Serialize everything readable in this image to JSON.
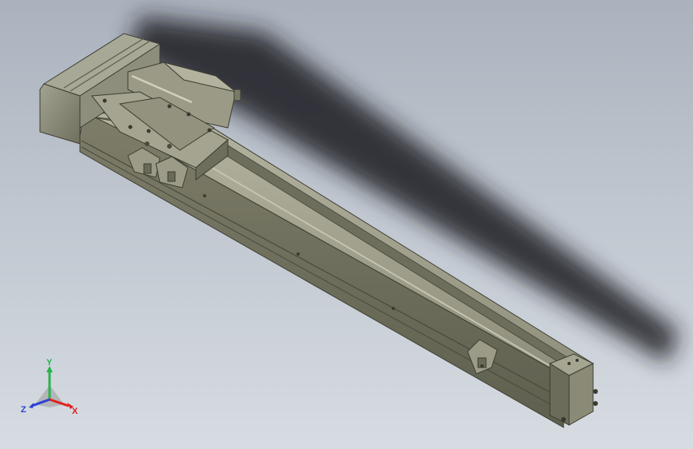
{
  "app": {
    "title": "",
    "view": "isometric"
  },
  "model": {
    "name": "",
    "components": [
      {
        "name": "servo-motor",
        "description_color": "#8c8c7c"
      },
      {
        "name": "actuator-rail",
        "description_color": "#8a8a74"
      },
      {
        "name": "carriage",
        "description_color": "#8f8f7d"
      },
      {
        "name": "sensor-brackets",
        "description_color": "#9b9b87"
      },
      {
        "name": "end-block",
        "description_color": "#8c8c78"
      }
    ]
  },
  "triad": {
    "axes": [
      {
        "label": "Y",
        "color": "#27b34b"
      },
      {
        "label": "X",
        "color": "#e02020"
      },
      {
        "label": "Z",
        "color": "#2b3fd6"
      }
    ]
  },
  "colors": {
    "background_top": "#aab2bd",
    "background_bottom": "#d7dce2",
    "metal_light": "#a6a692",
    "metal_mid": "#8a8a76",
    "metal_dark": "#5c5c4c",
    "shadow": "#1c1f24"
  }
}
